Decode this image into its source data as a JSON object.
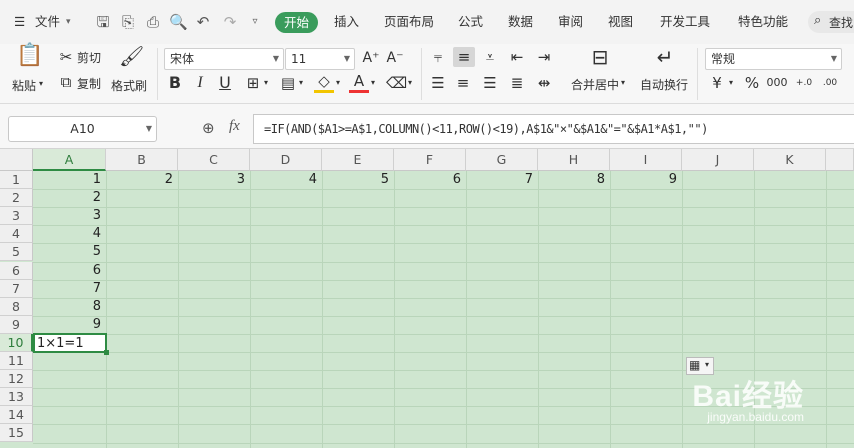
{
  "menubar": {
    "file_label": "文件",
    "tabs": [
      "开始",
      "插入",
      "页面布局",
      "公式",
      "数据",
      "审阅",
      "视图",
      "开发工具",
      "特色功能"
    ],
    "search_label": "查找"
  },
  "ribbon": {
    "paste": "粘贴",
    "cut": "剪切",
    "copy": "复制",
    "format_painter": "格式刷",
    "font_name": "宋体",
    "font_size": "11",
    "merge_center": "合并居中",
    "wrap_text": "自动换行",
    "number_format": "常规",
    "currency_symbol": "¥",
    "percent_symbol": "%",
    "thousands_symbol": "000",
    "increase_decimal": "+.0",
    "decrease_decimal": ".00",
    "bold": "B",
    "italic": "I",
    "underline": "U",
    "font_color_letter": "A",
    "grow_font": "A⁺",
    "shrink_font": "A⁻"
  },
  "formula_bar": {
    "name_box": "A10",
    "fx": "fx",
    "formula": "=IF(AND($A1>=A$1,COLUMN()<11,ROW()<19),A$1&\"×\"&$A1&\"=\"&$A1*A$1,\"\")"
  },
  "sheet": {
    "columns": [
      "A",
      "B",
      "C",
      "D",
      "E",
      "F",
      "G",
      "H",
      "I",
      "J",
      "K"
    ],
    "rows": [
      "1",
      "2",
      "3",
      "4",
      "5",
      "6",
      "7",
      "8",
      "9",
      "10",
      "11",
      "12",
      "13",
      "14",
      "15"
    ],
    "row1_values": [
      "1",
      "2",
      "3",
      "4",
      "5",
      "6",
      "7",
      "8",
      "9"
    ],
    "col_a_values": [
      "2",
      "3",
      "4",
      "5",
      "6",
      "7",
      "8",
      "9"
    ],
    "active_cell_value": "1×1=1"
  },
  "watermark": {
    "brand": "Bai经验",
    "url": "jingyan.baidu.com"
  },
  "colors": {
    "accent": "#3a9c5c",
    "grid_bg": "#cfe6d0",
    "active_border": "#2e8b43"
  }
}
